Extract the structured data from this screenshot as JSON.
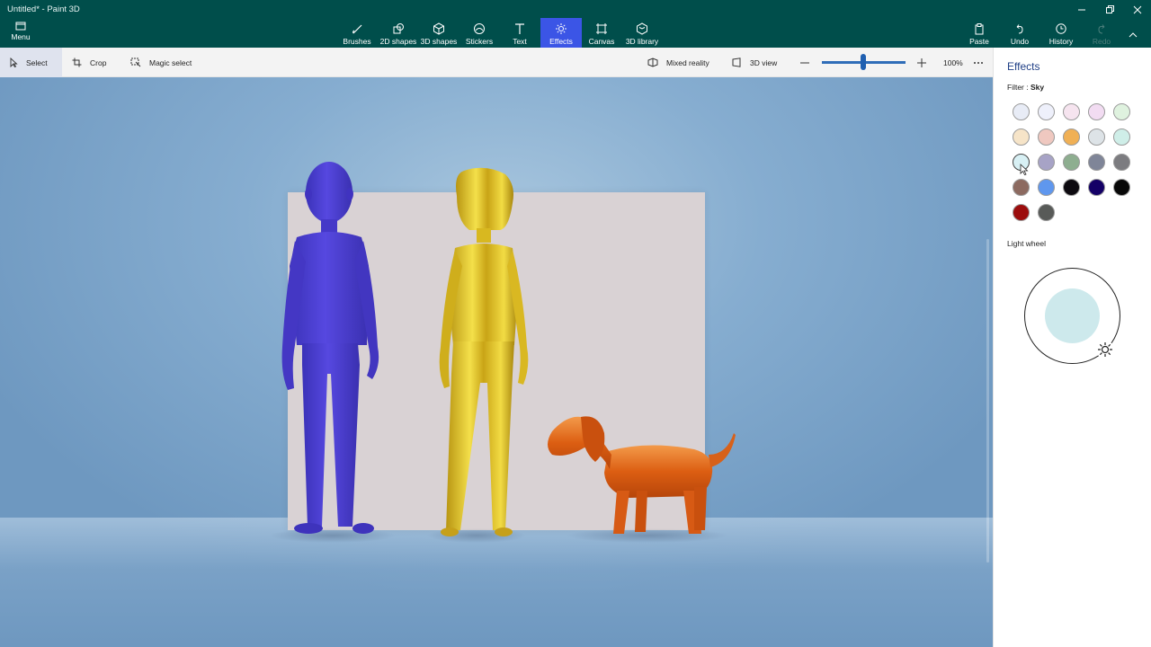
{
  "window": {
    "title": "Untitled* - Paint 3D",
    "controls": [
      "minimize",
      "maximize",
      "close"
    ]
  },
  "ribbon": {
    "menu_label": "Menu",
    "tools": [
      {
        "label": "Brushes",
        "icon": "brush-icon"
      },
      {
        "label": "2D shapes",
        "icon": "2d-shapes-icon"
      },
      {
        "label": "3D shapes",
        "icon": "3d-shapes-icon"
      },
      {
        "label": "Stickers",
        "icon": "stickers-icon"
      },
      {
        "label": "Text",
        "icon": "text-icon"
      },
      {
        "label": "Effects",
        "icon": "effects-icon",
        "active": true
      },
      {
        "label": "Canvas",
        "icon": "canvas-icon"
      },
      {
        "label": "3D library",
        "icon": "3d-library-icon"
      }
    ],
    "right_tools": [
      {
        "label": "Paste",
        "icon": "paste-icon"
      },
      {
        "label": "Undo",
        "icon": "undo-icon"
      },
      {
        "label": "History",
        "icon": "history-icon"
      },
      {
        "label": "Redo",
        "icon": "redo-icon",
        "disabled": true
      }
    ]
  },
  "toolbar": {
    "select": "Select",
    "crop": "Crop",
    "magic_select": "Magic select",
    "mixed_reality": "Mixed reality",
    "view_3d": "3D view",
    "zoom": "100%",
    "zoom_level": 1.0
  },
  "effects_panel": {
    "title": "Effects",
    "filter_label": "Filter :",
    "filter_value": "Sky",
    "light_wheel_label": "Light wheel",
    "swatches": [
      "#e8ecf6",
      "#eef0fb",
      "#f6e4ef",
      "#f2dcf2",
      "#dff2df",
      "#f6e4c8",
      "#efc8c0",
      "#f0b055",
      "#dde3e7",
      "#cfeee8",
      "#d8f0f4",
      "#a7a3c6",
      "#8eae90",
      "#7f8598",
      "#7c7c80",
      "#8c6a60",
      "#5f97ee",
      "#0d0a10",
      "#140066",
      "#080808",
      "#9c0d0d",
      "#585a58"
    ],
    "selected_swatch": 10,
    "light_color": "#cde9ec"
  },
  "scene": {
    "canvas_color": "#d9d2d4",
    "objects": [
      {
        "name": "blue-person",
        "color": "#4a3fd0"
      },
      {
        "name": "gold-person",
        "color": "#e6c62a"
      },
      {
        "name": "orange-dog",
        "color": "#e06a1a"
      }
    ]
  }
}
